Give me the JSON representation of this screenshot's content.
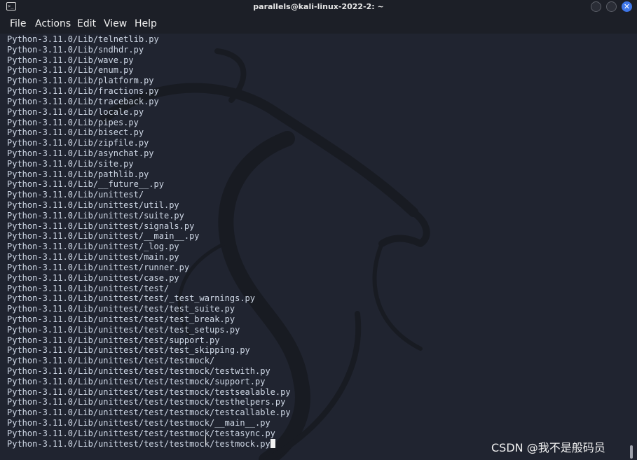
{
  "window": {
    "title": "parallels@kali-linux-2022-2: ~",
    "icon": "terminal-icon",
    "controls": [
      "minimize-icon",
      "maximize-icon",
      "close-icon"
    ],
    "close_glyph": "✕",
    "accent_color": "#3e76e8"
  },
  "menu": {
    "file": "File",
    "actions": "Actions",
    "edit": "Edit",
    "view": "View",
    "help": "Help"
  },
  "terminal": {
    "background_color": "#202430",
    "text_color": "#cfd8e6",
    "lines": [
      "Python-3.11.0/Lib/telnetlib.py",
      "Python-3.11.0/Lib/sndhdr.py",
      "Python-3.11.0/Lib/wave.py",
      "Python-3.11.0/Lib/enum.py",
      "Python-3.11.0/Lib/platform.py",
      "Python-3.11.0/Lib/fractions.py",
      "Python-3.11.0/Lib/traceback.py",
      "Python-3.11.0/Lib/locale.py",
      "Python-3.11.0/Lib/pipes.py",
      "Python-3.11.0/Lib/bisect.py",
      "Python-3.11.0/Lib/zipfile.py",
      "Python-3.11.0/Lib/asynchat.py",
      "Python-3.11.0/Lib/site.py",
      "Python-3.11.0/Lib/pathlib.py",
      "Python-3.11.0/Lib/__future__.py",
      "Python-3.11.0/Lib/unittest/",
      "Python-3.11.0/Lib/unittest/util.py",
      "Python-3.11.0/Lib/unittest/suite.py",
      "Python-3.11.0/Lib/unittest/signals.py",
      "Python-3.11.0/Lib/unittest/__main__.py",
      "Python-3.11.0/Lib/unittest/_log.py",
      "Python-3.11.0/Lib/unittest/main.py",
      "Python-3.11.0/Lib/unittest/runner.py",
      "Python-3.11.0/Lib/unittest/case.py",
      "Python-3.11.0/Lib/unittest/test/",
      "Python-3.11.0/Lib/unittest/test/_test_warnings.py",
      "Python-3.11.0/Lib/unittest/test/test_suite.py",
      "Python-3.11.0/Lib/unittest/test/test_break.py",
      "Python-3.11.0/Lib/unittest/test/test_setups.py",
      "Python-3.11.0/Lib/unittest/test/support.py",
      "Python-3.11.0/Lib/unittest/test/test_skipping.py",
      "Python-3.11.0/Lib/unittest/test/testmock/",
      "Python-3.11.0/Lib/unittest/test/testmock/testwith.py",
      "Python-3.11.0/Lib/unittest/test/testmock/support.py",
      "Python-3.11.0/Lib/unittest/test/testmock/testsealable.py",
      "Python-3.11.0/Lib/unittest/test/testmock/testhelpers.py",
      "Python-3.11.0/Lib/unittest/test/testmock/testcallable.py",
      "Python-3.11.0/Lib/unittest/test/testmock/__main__.py",
      "Python-3.11.0/Lib/unittest/test/testmock/testasync.py",
      "Python-3.11.0/Lib/unittest/test/testmock/testmock.py"
    ]
  },
  "watermark": "CSDN @我不是般码员"
}
